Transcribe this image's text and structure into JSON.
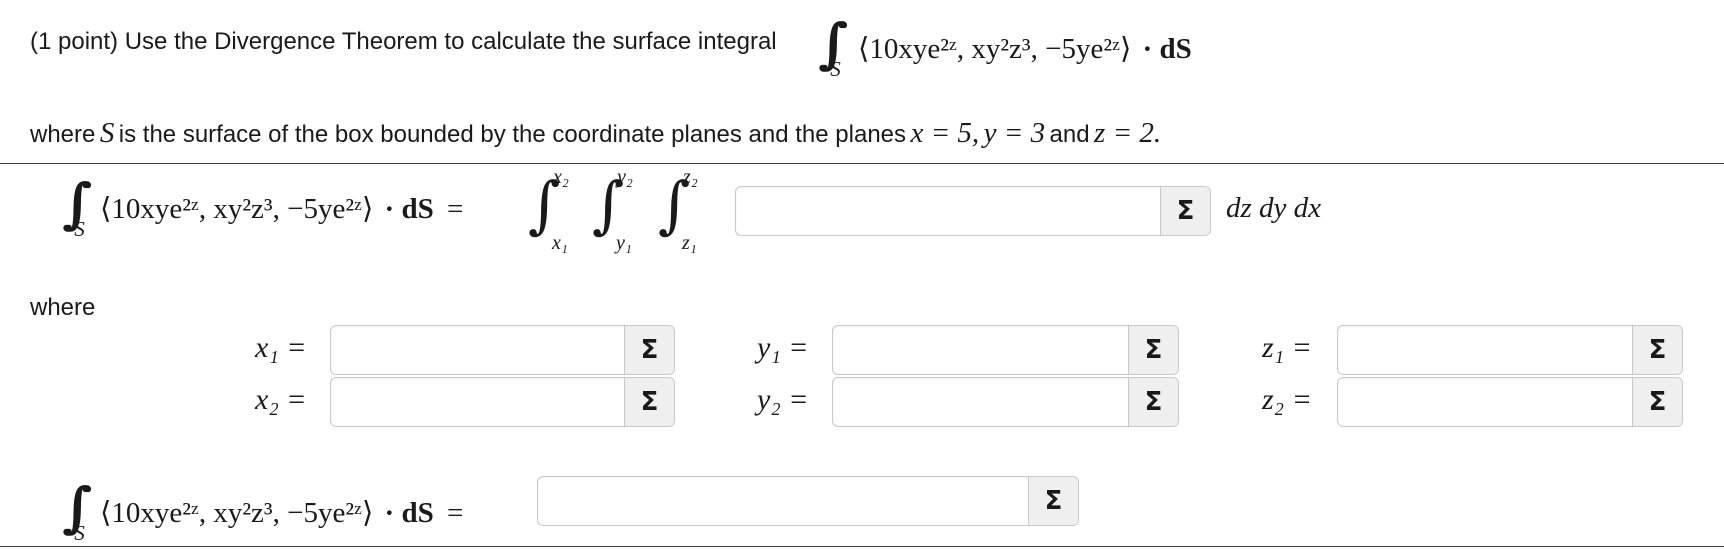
{
  "question": {
    "points_label": "(1 point)",
    "intro_text": "Use the Divergence Theorem to calculate the surface integral",
    "where_text_a": "where",
    "surface_symbol": "S",
    "where_text_b": "is the surface of the box bounded by the coordinate planes and the planes",
    "plane_x": "x = 5,",
    "plane_y": "y = 3",
    "and_text": "and",
    "plane_z": "z = 2."
  },
  "integrand": {
    "vector": "⟨10xye²ᶻ, xy²z³, −5ye²ᶻ⟩",
    "dot_dS": "· dS",
    "equals": "="
  },
  "triple_integral": {
    "upper_x": "x₂",
    "lower_x": "x₁",
    "upper_y": "y₂",
    "lower_y": "y₁",
    "upper_z": "z₂",
    "lower_z": "z₁",
    "differential": "dz dy dx"
  },
  "where_label": "where",
  "limits": {
    "x1_label": "x₁ =",
    "x2_label": "x₂ =",
    "y1_label": "y₁ =",
    "y2_label": "y₂ =",
    "z1_label": "z₁ =",
    "z2_label": "z₂ ="
  },
  "inputs": {
    "integrand_value": "",
    "x1_value": "",
    "x2_value": "",
    "y1_value": "",
    "y2_value": "",
    "z1_value": "",
    "z2_value": "",
    "final_value": ""
  },
  "equation_editor_button": "Σ",
  "colors": {
    "text": "#1a1a1a",
    "rule": "#3a3a3a",
    "input_border": "#c9c9c9",
    "sigma_bg": "#efefef",
    "header_accent": "#2d6a5a"
  }
}
